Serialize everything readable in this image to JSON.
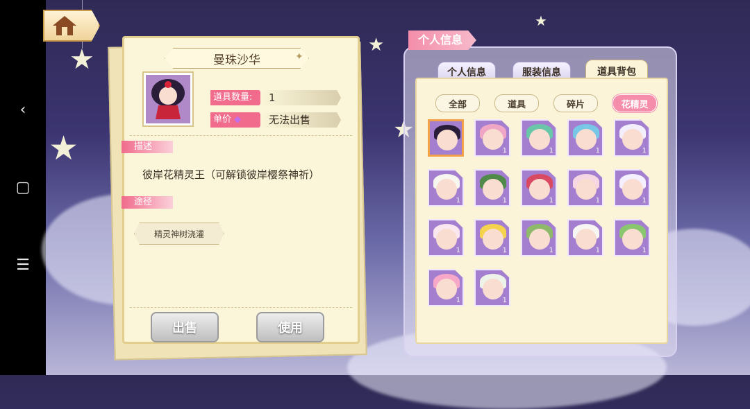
{
  "item": {
    "name": "曼珠沙华",
    "qty_label": "道具数量:",
    "qty_value": "1",
    "price_label": "单价",
    "price_value": "无法出售",
    "desc_header": "描述",
    "description": "彼岸花精灵王（可解锁彼岸樱祭神祈）",
    "route_header": "途径",
    "route": "精灵神树浇灌",
    "sell_label": "出售",
    "use_label": "使用"
  },
  "panel": {
    "title": "个人信息",
    "tabs": [
      {
        "label": "个人信息",
        "active": false
      },
      {
        "label": "服装信息",
        "active": false
      },
      {
        "label": "道具背包",
        "active": true
      }
    ],
    "subtabs": [
      {
        "label": "全部",
        "active": false
      },
      {
        "label": "道具",
        "active": false
      },
      {
        "label": "碎片",
        "active": false
      },
      {
        "label": "花精灵",
        "active": true
      }
    ],
    "items": [
      {
        "count": "",
        "hair": "#2a1d3a",
        "selected": true
      },
      {
        "count": "1",
        "hair": "#f0a7c5"
      },
      {
        "count": "1",
        "hair": "#69c6a8"
      },
      {
        "count": "1",
        "hair": "#79c7e7"
      },
      {
        "count": "1",
        "hair": "#f2eefc"
      },
      {
        "count": "1",
        "hair": "#f7f7f0"
      },
      {
        "count": "1",
        "hair": "#4f8a4a"
      },
      {
        "count": "1",
        "hair": "#d94a62"
      },
      {
        "count": "1",
        "hair": "#f6d6e2"
      },
      {
        "count": "1",
        "hair": "#f4f0ff"
      },
      {
        "count": "1",
        "hair": "#fae7f0"
      },
      {
        "count": "1",
        "hair": "#f5d34f"
      },
      {
        "count": "1",
        "hair": "#8fb96a"
      },
      {
        "count": "1",
        "hair": "#f7f6f2"
      },
      {
        "count": "1",
        "hair": "#89c66f"
      },
      {
        "count": "1",
        "hair": "#f7a8c8"
      },
      {
        "count": "1",
        "hair": "#eef3ea"
      }
    ]
  },
  "system": {
    "back": "‹",
    "home": "▢",
    "menu": "☰"
  },
  "colors": {
    "accent_pink": "#f06b8c",
    "slot_purple": "#a47fd0",
    "panel_cream": "#fbf6d9"
  }
}
